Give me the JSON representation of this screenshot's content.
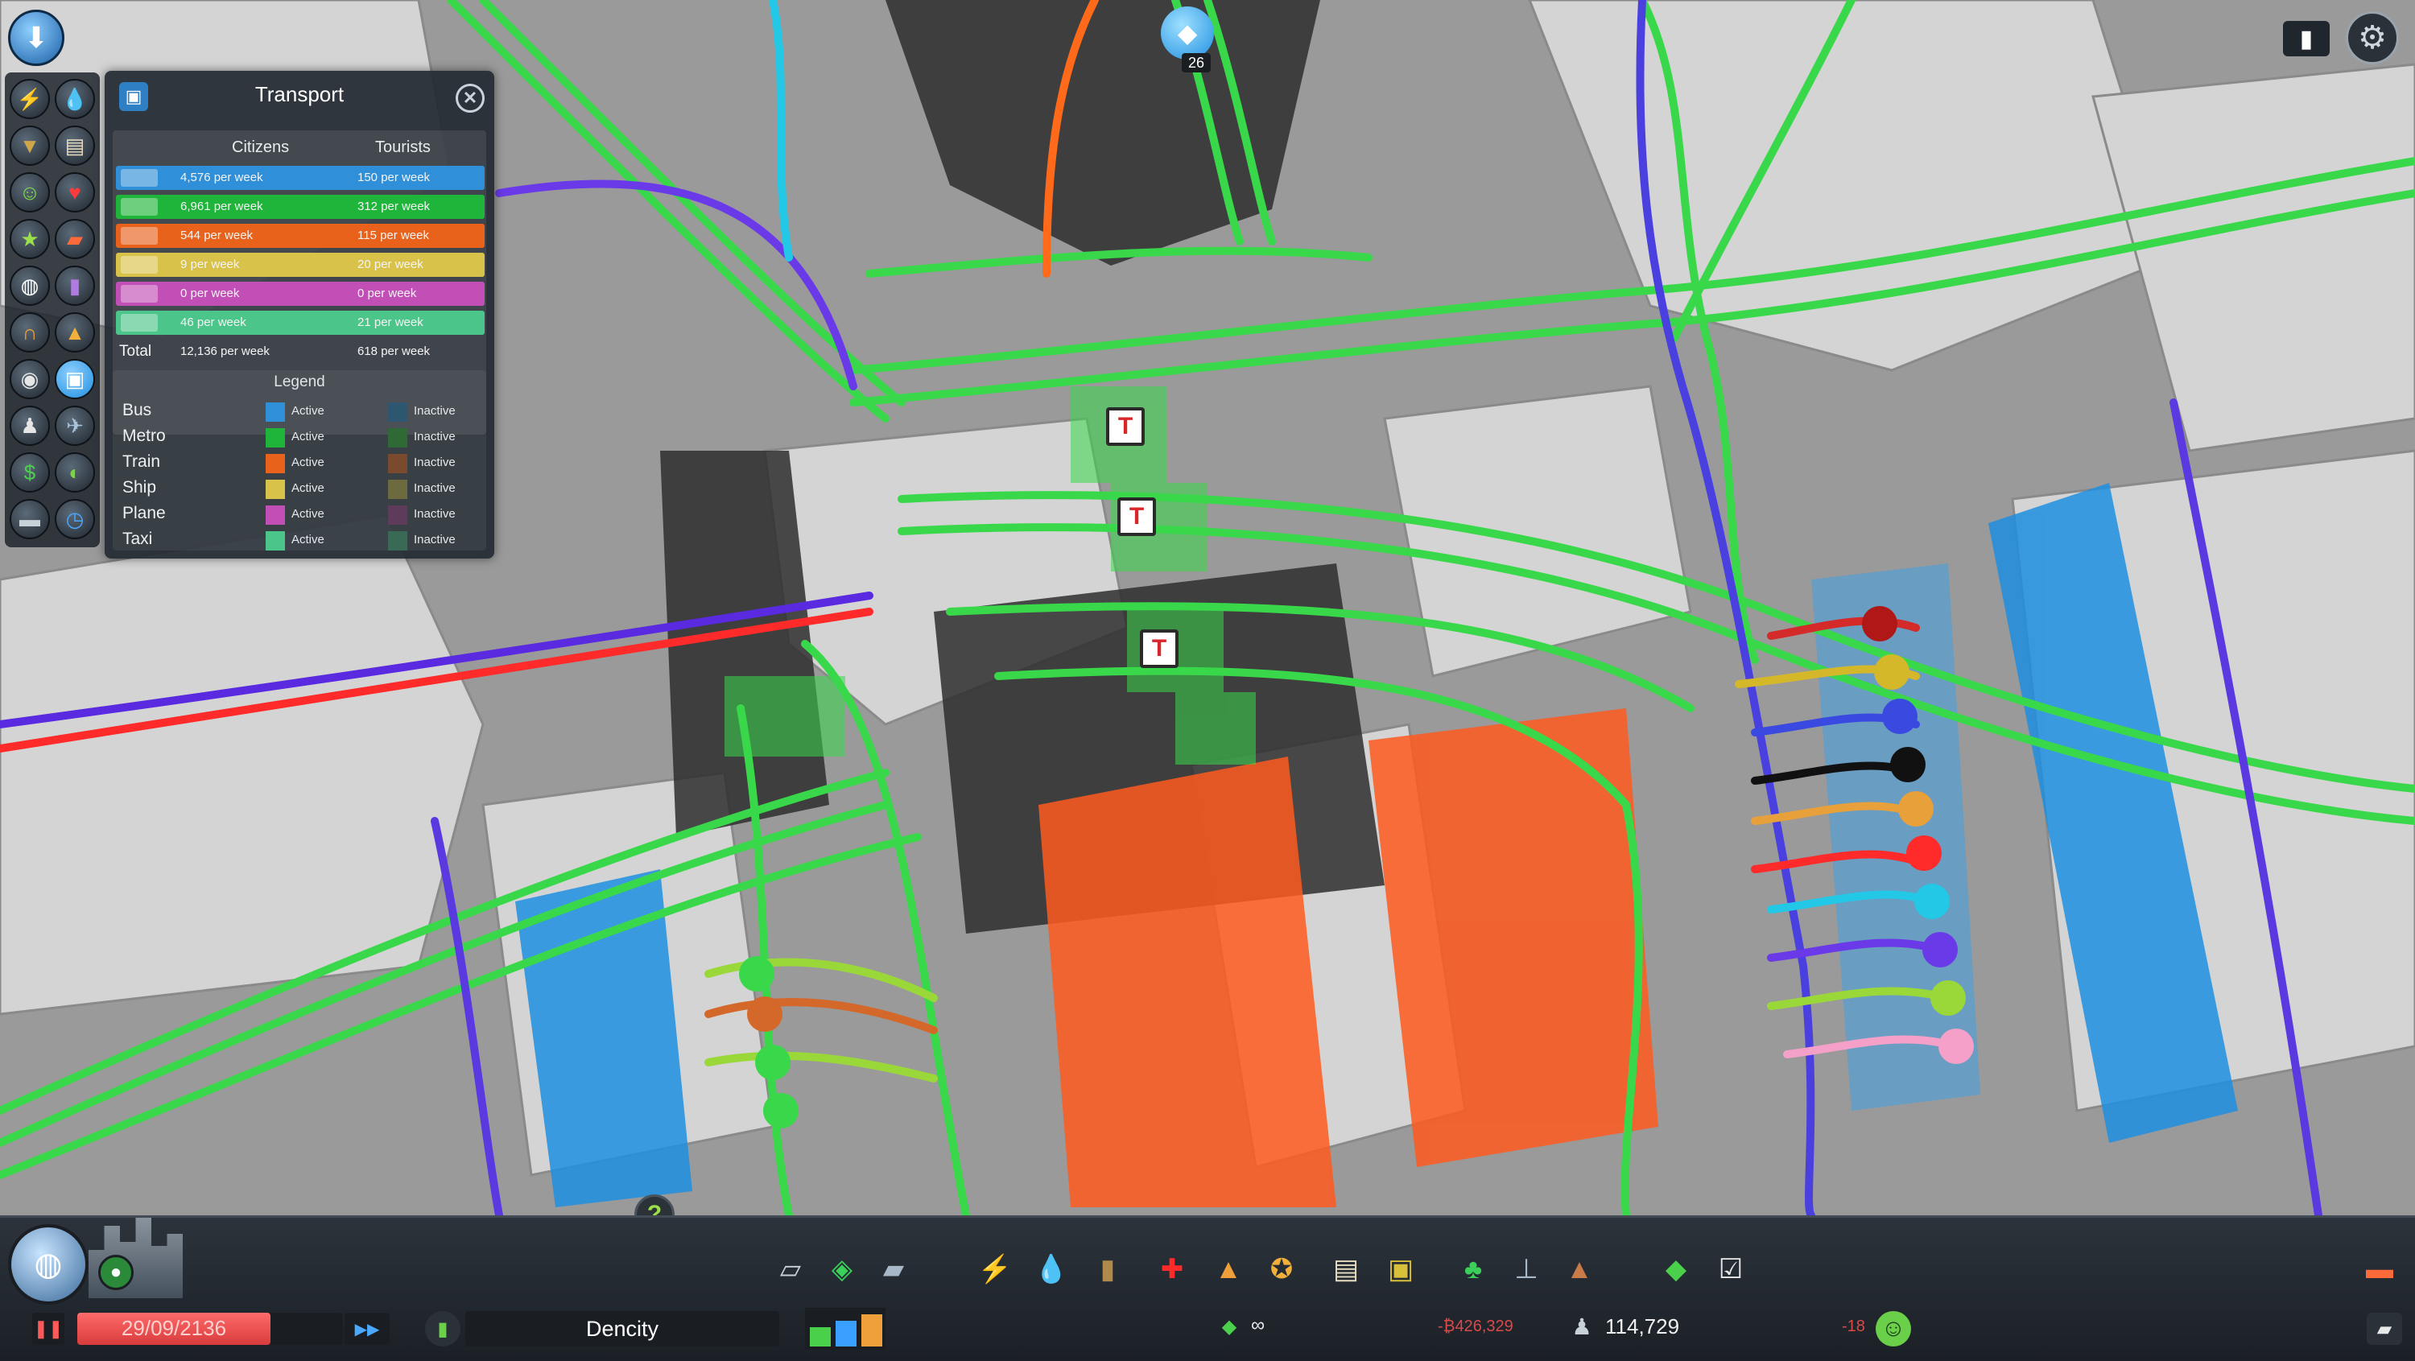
{
  "panel": {
    "title": "Transport",
    "columns": {
      "citizens": "Citizens",
      "tourists": "Tourists"
    },
    "rows": [
      {
        "mode": "bus",
        "color": "#2f8fd8",
        "citizens": "4,576 per week",
        "tourists": "150 per week"
      },
      {
        "mode": "metro",
        "color": "#1fb43a",
        "citizens": "6,961 per week",
        "tourists": "312 per week"
      },
      {
        "mode": "train",
        "color": "#e8621c",
        "citizens": "544 per week",
        "tourists": "115 per week"
      },
      {
        "mode": "ship",
        "color": "#d9c24a",
        "citizens": "9 per week",
        "tourists": "20 per week"
      },
      {
        "mode": "plane",
        "color": "#c14fb6",
        "citizens": "0 per week",
        "tourists": "0 per week"
      },
      {
        "mode": "taxi",
        "color": "#4cc58a",
        "citizens": "46 per week",
        "tourists": "21 per week"
      }
    ],
    "total": {
      "label": "Total",
      "citizens": "12,136 per week",
      "tourists": "618 per week"
    },
    "legend": {
      "title": "Legend",
      "active_label": "Active",
      "inactive_label": "Inactive",
      "items": [
        {
          "name": "Bus",
          "active": "#2f8fd8",
          "inactive": "#2d5670"
        },
        {
          "name": "Metro",
          "active": "#1fb43a",
          "inactive": "#2f6a36"
        },
        {
          "name": "Train",
          "active": "#e8621c",
          "inactive": "#7a4a2e"
        },
        {
          "name": "Ship",
          "active": "#d9c24a",
          "inactive": "#6e6a40"
        },
        {
          "name": "Plane",
          "active": "#c14fb6",
          "inactive": "#5e3a5b"
        },
        {
          "name": "Taxi",
          "active": "#4cc58a",
          "inactive": "#3a6a55"
        }
      ]
    }
  },
  "map": {
    "stop_badge": "26",
    "metro_station_label": "T",
    "help_icon": "?"
  },
  "bottom_bar": {
    "date": "29/09/2136",
    "info_view": "Dencity",
    "money": "∞",
    "money_change": "-₿426,329",
    "population": "114,729",
    "population_change": "-18"
  },
  "icons": {
    "left_toolbar": [
      "electricity-icon",
      "water-icon",
      "garbage-icon",
      "education-icon",
      "happiness-icon",
      "health-icon",
      "landvalue-icon",
      "fire-icon",
      "traffic-icon",
      "noise-icon",
      "public-transport-icon",
      "crime-icon",
      "population-icon",
      "tourism-icon",
      "money-icon",
      "natural-resources-icon",
      "road-maintenance-icon",
      "time-icon"
    ]
  }
}
